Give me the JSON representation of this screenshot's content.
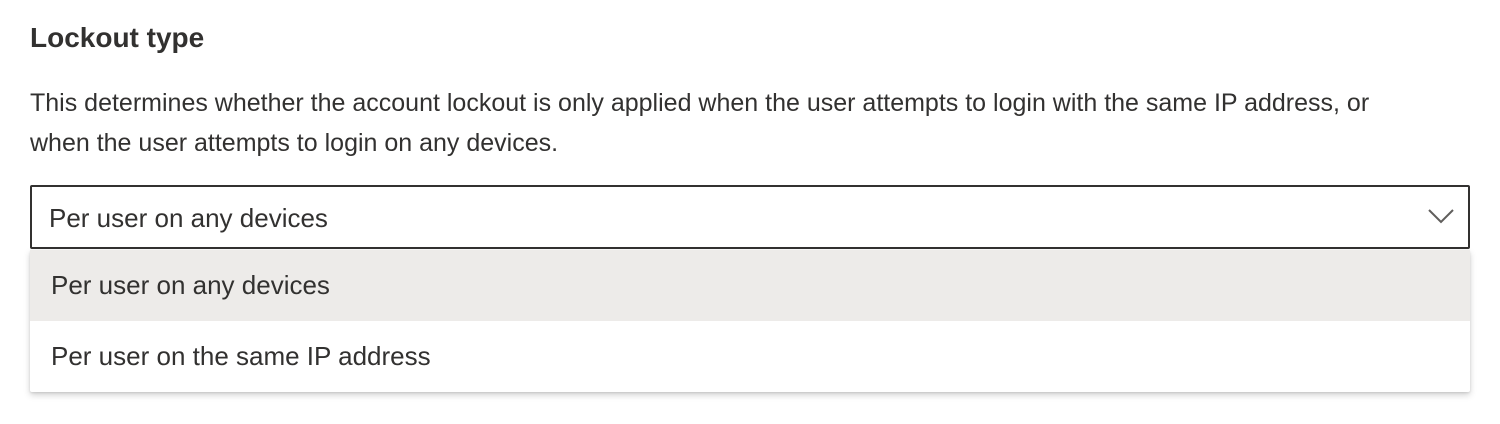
{
  "section": {
    "heading": "Lockout type",
    "description": "This determines whether the account lockout is only applied when the user attempts to login with the same IP address, or when the user attempts to login on any devices."
  },
  "dropdown": {
    "selected_value": "Per user on any devices",
    "icon": "chevron-down-icon",
    "border_color": "#323130"
  },
  "menu": {
    "options": [
      {
        "label": "Per user on any devices",
        "selected": true
      },
      {
        "label": "Per user on the same IP address",
        "selected": false
      }
    ],
    "selected_bg": "#edebe9"
  }
}
